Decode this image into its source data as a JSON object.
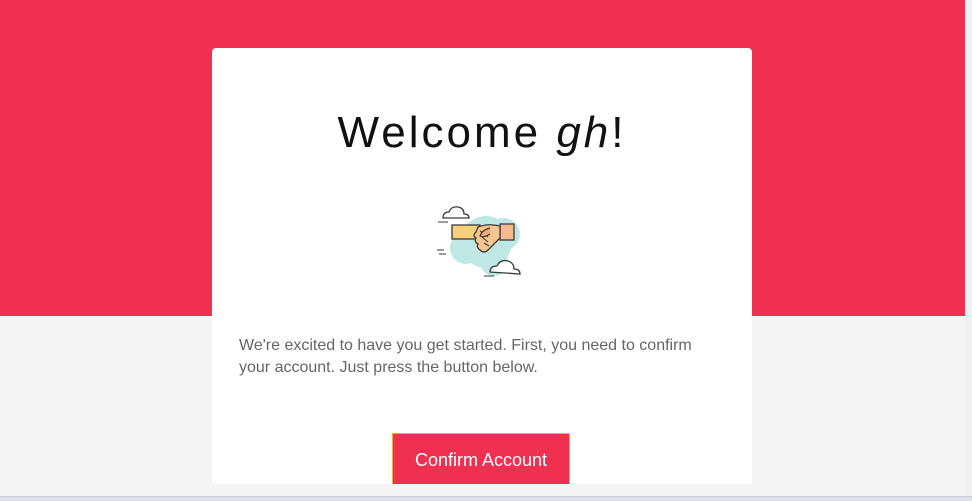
{
  "header": {
    "welcome_prefix": "Welcome ",
    "username": "gh",
    "welcome_suffix": "!"
  },
  "illustration": {
    "icon": "handshake-icon"
  },
  "body": {
    "message": "We're excited to have you get started. First, you need to confirm your account. Just press the button below."
  },
  "actions": {
    "confirm_label": "Confirm Account"
  },
  "colors": {
    "brand": "#f03051",
    "background": "#f4f4f4",
    "card": "#ffffff",
    "text": "#666666"
  }
}
